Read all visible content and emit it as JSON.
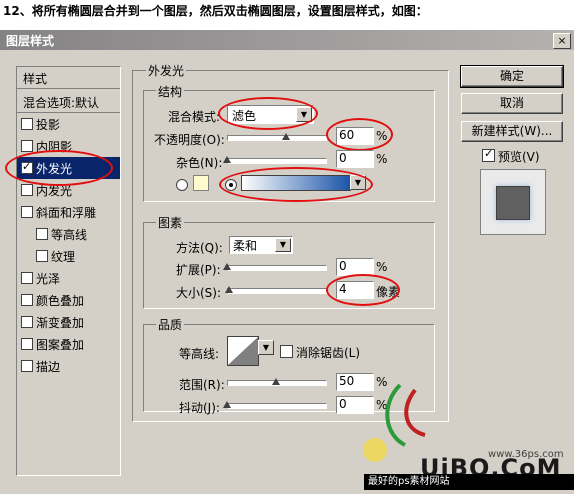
{
  "instruction": "12、将所有椭圆层合并到一个图层，然后双击椭圆图层，设置图层样式，如图：",
  "window": {
    "title": "图层样式",
    "close_glyph": "×"
  },
  "sidebar": {
    "header": "样式",
    "blend_default": "混合选项:默认",
    "items": [
      {
        "label": "投影",
        "checked": false
      },
      {
        "label": "内阴影",
        "checked": false
      },
      {
        "label": "外发光",
        "checked": true,
        "selected": true
      },
      {
        "label": "内发光",
        "checked": false
      },
      {
        "label": "斜面和浮雕",
        "checked": false
      },
      {
        "label": "等高线",
        "checked": false,
        "indent": true
      },
      {
        "label": "纹理",
        "checked": false,
        "indent": true
      },
      {
        "label": "光泽",
        "checked": false
      },
      {
        "label": "颜色叠加",
        "checked": false
      },
      {
        "label": "渐变叠加",
        "checked": false
      },
      {
        "label": "图案叠加",
        "checked": false
      },
      {
        "label": "描边",
        "checked": false
      }
    ]
  },
  "outer_glow": {
    "section_title": "外发光",
    "structure": {
      "title": "结构",
      "blend_mode_label": "混合模式:",
      "blend_mode_value": "滤色",
      "opacity_label": "不透明度(O):",
      "opacity_value": "60",
      "opacity_fraction": 0.6,
      "noise_label": "杂色(N):",
      "noise_value": "0",
      "noise_fraction": 0,
      "percent": "%"
    },
    "elements": {
      "title": "图素",
      "method_label": "方法(Q):",
      "method_value": "柔和",
      "spread_label": "扩展(P):",
      "spread_value": "0",
      "spread_fraction": 0,
      "size_label": "大小(S):",
      "size_value": "4",
      "size_fraction": 0.02,
      "percent": "%",
      "pixel_unit": "像素"
    },
    "quality": {
      "title": "品质",
      "contour_label": "等高线:",
      "antialias_label": "消除锯齿(L)",
      "range_label": "范围(R):",
      "range_value": "50",
      "range_fraction": 0.5,
      "jitter_label": "抖动(J):",
      "jitter_value": "0",
      "jitter_fraction": 0,
      "percent": "%"
    }
  },
  "buttons": {
    "ok": "确定",
    "cancel": "取消",
    "new_style": "新建样式(W)...",
    "preview": "预览(V)"
  },
  "watermark": {
    "site": "www.36ps.com",
    "brand": "UiBQ.CoM",
    "tagline": "最好的ps素材网站"
  },
  "colors": {
    "dialog_bg": "#d4d0c8",
    "selection": "#0a246a",
    "glow_swatch": "#fffacd",
    "gradient_start": "#ffffff",
    "gradient_end": "#1a54a8",
    "annotation": "#e01010"
  },
  "icons": [
    "close-icon",
    "dropdown-arrow-icon",
    "slider-thumb-icon",
    "contour-icon",
    "preview-swatch-icon"
  ]
}
